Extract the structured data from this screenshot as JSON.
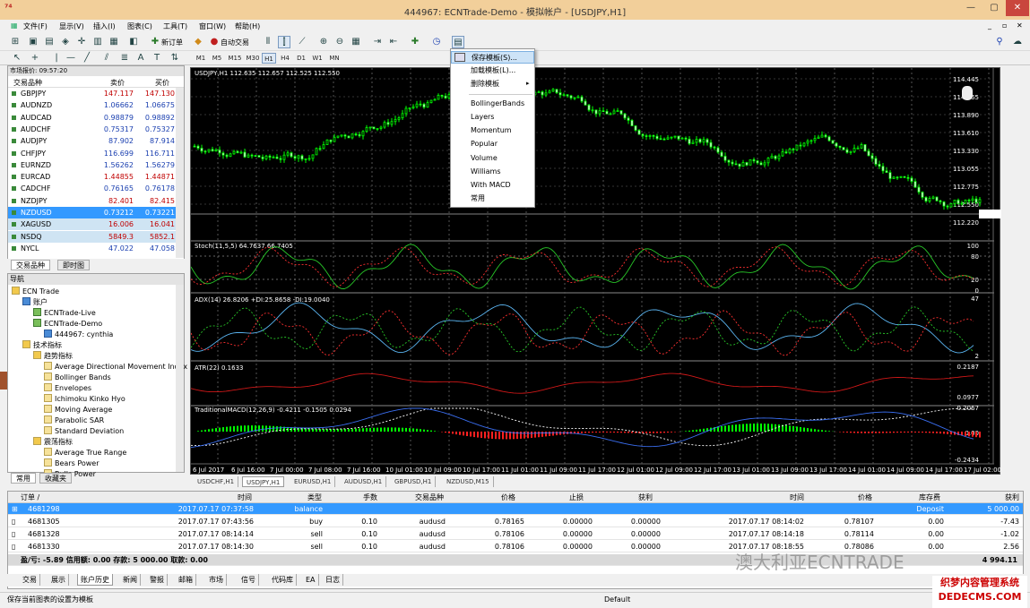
{
  "window": {
    "title": "444967: ECNTrade-Demo - 模拟帐户 - [USDJPY,H1]"
  },
  "menu": [
    "文件(F)",
    "显示(V)",
    "插入(I)",
    "图表(C)",
    "工具(T)",
    "窗口(W)",
    "帮助(H)"
  ],
  "toolbar": {
    "new_order": "新订单",
    "auto_trade": "自动交易"
  },
  "timeframes": [
    "M1",
    "M5",
    "M15",
    "M30",
    "H1",
    "H4",
    "D1",
    "W1",
    "MN"
  ],
  "market_watch": {
    "header": "市场报价: 09:57:20",
    "col_symbol": "交易品种",
    "col_bid": "卖价",
    "col_ask": "买价",
    "rows": [
      {
        "sym": "GBPJPY",
        "bid": "147.117",
        "ask": "147.130",
        "color": "#c00000"
      },
      {
        "sym": "AUDNZD",
        "bid": "1.06662",
        "ask": "1.06675",
        "color": "#1a3fb0"
      },
      {
        "sym": "AUDCAD",
        "bid": "0.98879",
        "ask": "0.98892",
        "color": "#1a3fb0"
      },
      {
        "sym": "AUDCHF",
        "bid": "0.75317",
        "ask": "0.75327",
        "color": "#1a3fb0"
      },
      {
        "sym": "AUDJPY",
        "bid": "87.902",
        "ask": "87.914",
        "color": "#1a3fb0"
      },
      {
        "sym": "CHFJPY",
        "bid": "116.699",
        "ask": "116.711",
        "color": "#1a3fb0"
      },
      {
        "sym": "EURNZD",
        "bid": "1.56262",
        "ask": "1.56279",
        "color": "#1a3fb0"
      },
      {
        "sym": "EURCAD",
        "bid": "1.44855",
        "ask": "1.44871",
        "color": "#c00000"
      },
      {
        "sym": "CADCHF",
        "bid": "0.76165",
        "ask": "0.76178",
        "color": "#1a3fb0"
      },
      {
        "sym": "NZDJPY",
        "bid": "82.401",
        "ask": "82.415",
        "color": "#c00000"
      },
      {
        "sym": "NZDUSD",
        "bid": "0.73212",
        "ask": "0.73221",
        "color": "#ffffff"
      },
      {
        "sym": "XAGUSD",
        "bid": "16.006",
        "ask": "16.041",
        "color": "#c00000"
      },
      {
        "sym": "NSDQ",
        "bid": "5849.3",
        "ask": "5852.1",
        "color": "#c00000"
      },
      {
        "sym": "NYCL",
        "bid": "47.022",
        "ask": "47.058",
        "color": "#1a3fb0"
      }
    ],
    "tabs": [
      "交易品种",
      "即时图"
    ]
  },
  "navigator": {
    "header": "导航",
    "items": [
      "ECN Trade",
      "账户",
      "ECNTrade-Live",
      "ECNTrade-Demo",
      "444967: cynthia",
      "技术指标",
      "趋势指标",
      "Average Directional Movement Index",
      "Bollinger Bands",
      "Envelopes",
      "Ichimoku Kinko Hyo",
      "Moving Average",
      "Parabolic SAR",
      "Standard Deviation",
      "震荡指标",
      "Average True Range",
      "Bears Power",
      "Bulls Power"
    ],
    "tabs": [
      "常用",
      "收藏夹"
    ]
  },
  "chart": {
    "header": "USDJPY,H1  112.635 112.657 112.525 112.550",
    "price_ticks": [
      "114.445",
      "114.165",
      "113.890",
      "113.610",
      "113.330",
      "113.055",
      "112.775",
      "112.550",
      "112.220"
    ],
    "stoch_label": "Stoch(11,5,5) 64.7637 66.7405",
    "stoch_ticks": [
      "100",
      "80",
      "20",
      "0"
    ],
    "adx_label": "ADX(14) 26.8206 +DI:25.8658 -DI:19.0040",
    "adx_ticks": [
      "47",
      "2"
    ],
    "atr_label": "ATR(22) 0.1633",
    "atr_ticks": [
      "0.2187",
      "0.0977"
    ],
    "macd_label": "TraditionalMACD(12,26,9) -0.4211 -0.1505 0.0294",
    "macd_ticks": [
      "0.2067",
      "0.00",
      "-0.2434"
    ],
    "time_ticks": [
      "6 Jul 2017",
      "6 Jul 16:00",
      "7 Jul 00:00",
      "7 Jul 08:00",
      "7 Jul 16:00",
      "10 Jul 01:00",
      "10 Jul 09:00",
      "10 Jul 17:00",
      "11 Jul 01:00",
      "11 Jul 09:00",
      "11 Jul 17:00",
      "12 Jul 01:00",
      "12 Jul 09:00",
      "12 Jul 17:00",
      "13 Jul 01:00",
      "13 Jul 09:00",
      "13 Jul 17:00",
      "14 Jul 01:00",
      "14 Jul 09:00",
      "14 Jul 17:00",
      "17 Jul 02:00"
    ]
  },
  "chart_tabs": [
    "USDCHF,H1",
    "USDJPY,H1",
    "EURUSD,H1",
    "AUDUSD,H1",
    "GBPUSD,H1",
    "NZDUSD,M15"
  ],
  "template_menu": {
    "items": [
      "保存模板(S)...",
      "加载模板(L)...",
      "删除模板",
      "BollingerBands",
      "Layers",
      "Momentum",
      "Popular",
      "Volume",
      "Williams",
      "With MACD",
      "常用"
    ]
  },
  "terminal": {
    "headers": [
      "订单 /",
      "时间",
      "类型",
      "手数",
      "交易品种",
      "价格",
      "止损",
      "获利",
      "时间",
      "价格",
      "库存费",
      "获利"
    ],
    "rows": [
      [
        "4681298",
        "2017.07.17 07:37:58",
        "balance",
        "",
        "",
        "",
        "",
        "",
        "",
        "",
        "Deposit",
        "5 000.00"
      ],
      [
        "4681305",
        "2017.07.17 07:43:56",
        "buy",
        "0.10",
        "audusd",
        "0.78165",
        "0.00000",
        "0.00000",
        "2017.07.17 08:14:02",
        "0.78107",
        "0.00",
        "-7.43"
      ],
      [
        "4681328",
        "2017.07.17 08:14:14",
        "sell",
        "0.10",
        "audusd",
        "0.78106",
        "0.00000",
        "0.00000",
        "2017.07.17 08:14:18",
        "0.78114",
        "0.00",
        "-1.02"
      ],
      [
        "4681330",
        "2017.07.17 08:14:30",
        "sell",
        "0.10",
        "audusd",
        "0.78106",
        "0.00000",
        "0.00000",
        "2017.07.17 08:18:55",
        "0.78086",
        "0.00",
        "2.56"
      ]
    ],
    "summary": "盈/亏: -5.89 信用额: 0.00 存款: 5 000.00 取款: 0.00",
    "summary_total": "4 994.11",
    "tabs": [
      "交易",
      "展示",
      "账户历史",
      "新闻",
      "警报",
      "邮箱",
      "市场",
      "信号",
      "代码库",
      "EA",
      "日志"
    ]
  },
  "status": {
    "left": "保存当前图表的设置为模板",
    "mid": "Default"
  },
  "watermark": "澳大利亚ECNTRADE",
  "watermark2": "织梦内容管理系统 DEDECMS.COM"
}
